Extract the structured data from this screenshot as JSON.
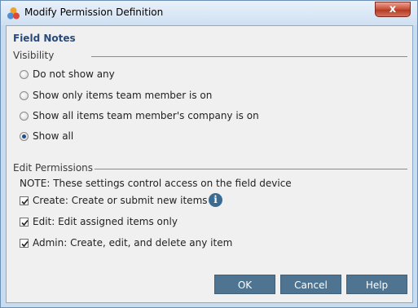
{
  "window": {
    "title": "Modify Permission Definition",
    "close_glyph": "x"
  },
  "section_title": "Field Notes",
  "visibility": {
    "label": "Visibility",
    "options": [
      {
        "label": "Do not show any",
        "selected": false
      },
      {
        "label": "Show only items team member is on",
        "selected": false
      },
      {
        "label": "Show all items team member's company is on",
        "selected": false
      },
      {
        "label": "Show all",
        "selected": true
      }
    ]
  },
  "edit_permissions": {
    "label": "Edit Permissions",
    "note": "NOTE: These settings control access on the field device",
    "options": [
      {
        "label": "Create: Create or submit new items",
        "checked": true
      },
      {
        "label": "Edit: Edit assigned items only",
        "checked": true
      },
      {
        "label": "Admin: Create, edit, and delete any item",
        "checked": true
      }
    ],
    "info_glyph": "i"
  },
  "buttons": {
    "ok": "OK",
    "cancel": "Cancel",
    "help": "Help"
  },
  "icons": {
    "app": "colored-circles-app-icon",
    "info": "info-icon",
    "close": "close-icon"
  }
}
